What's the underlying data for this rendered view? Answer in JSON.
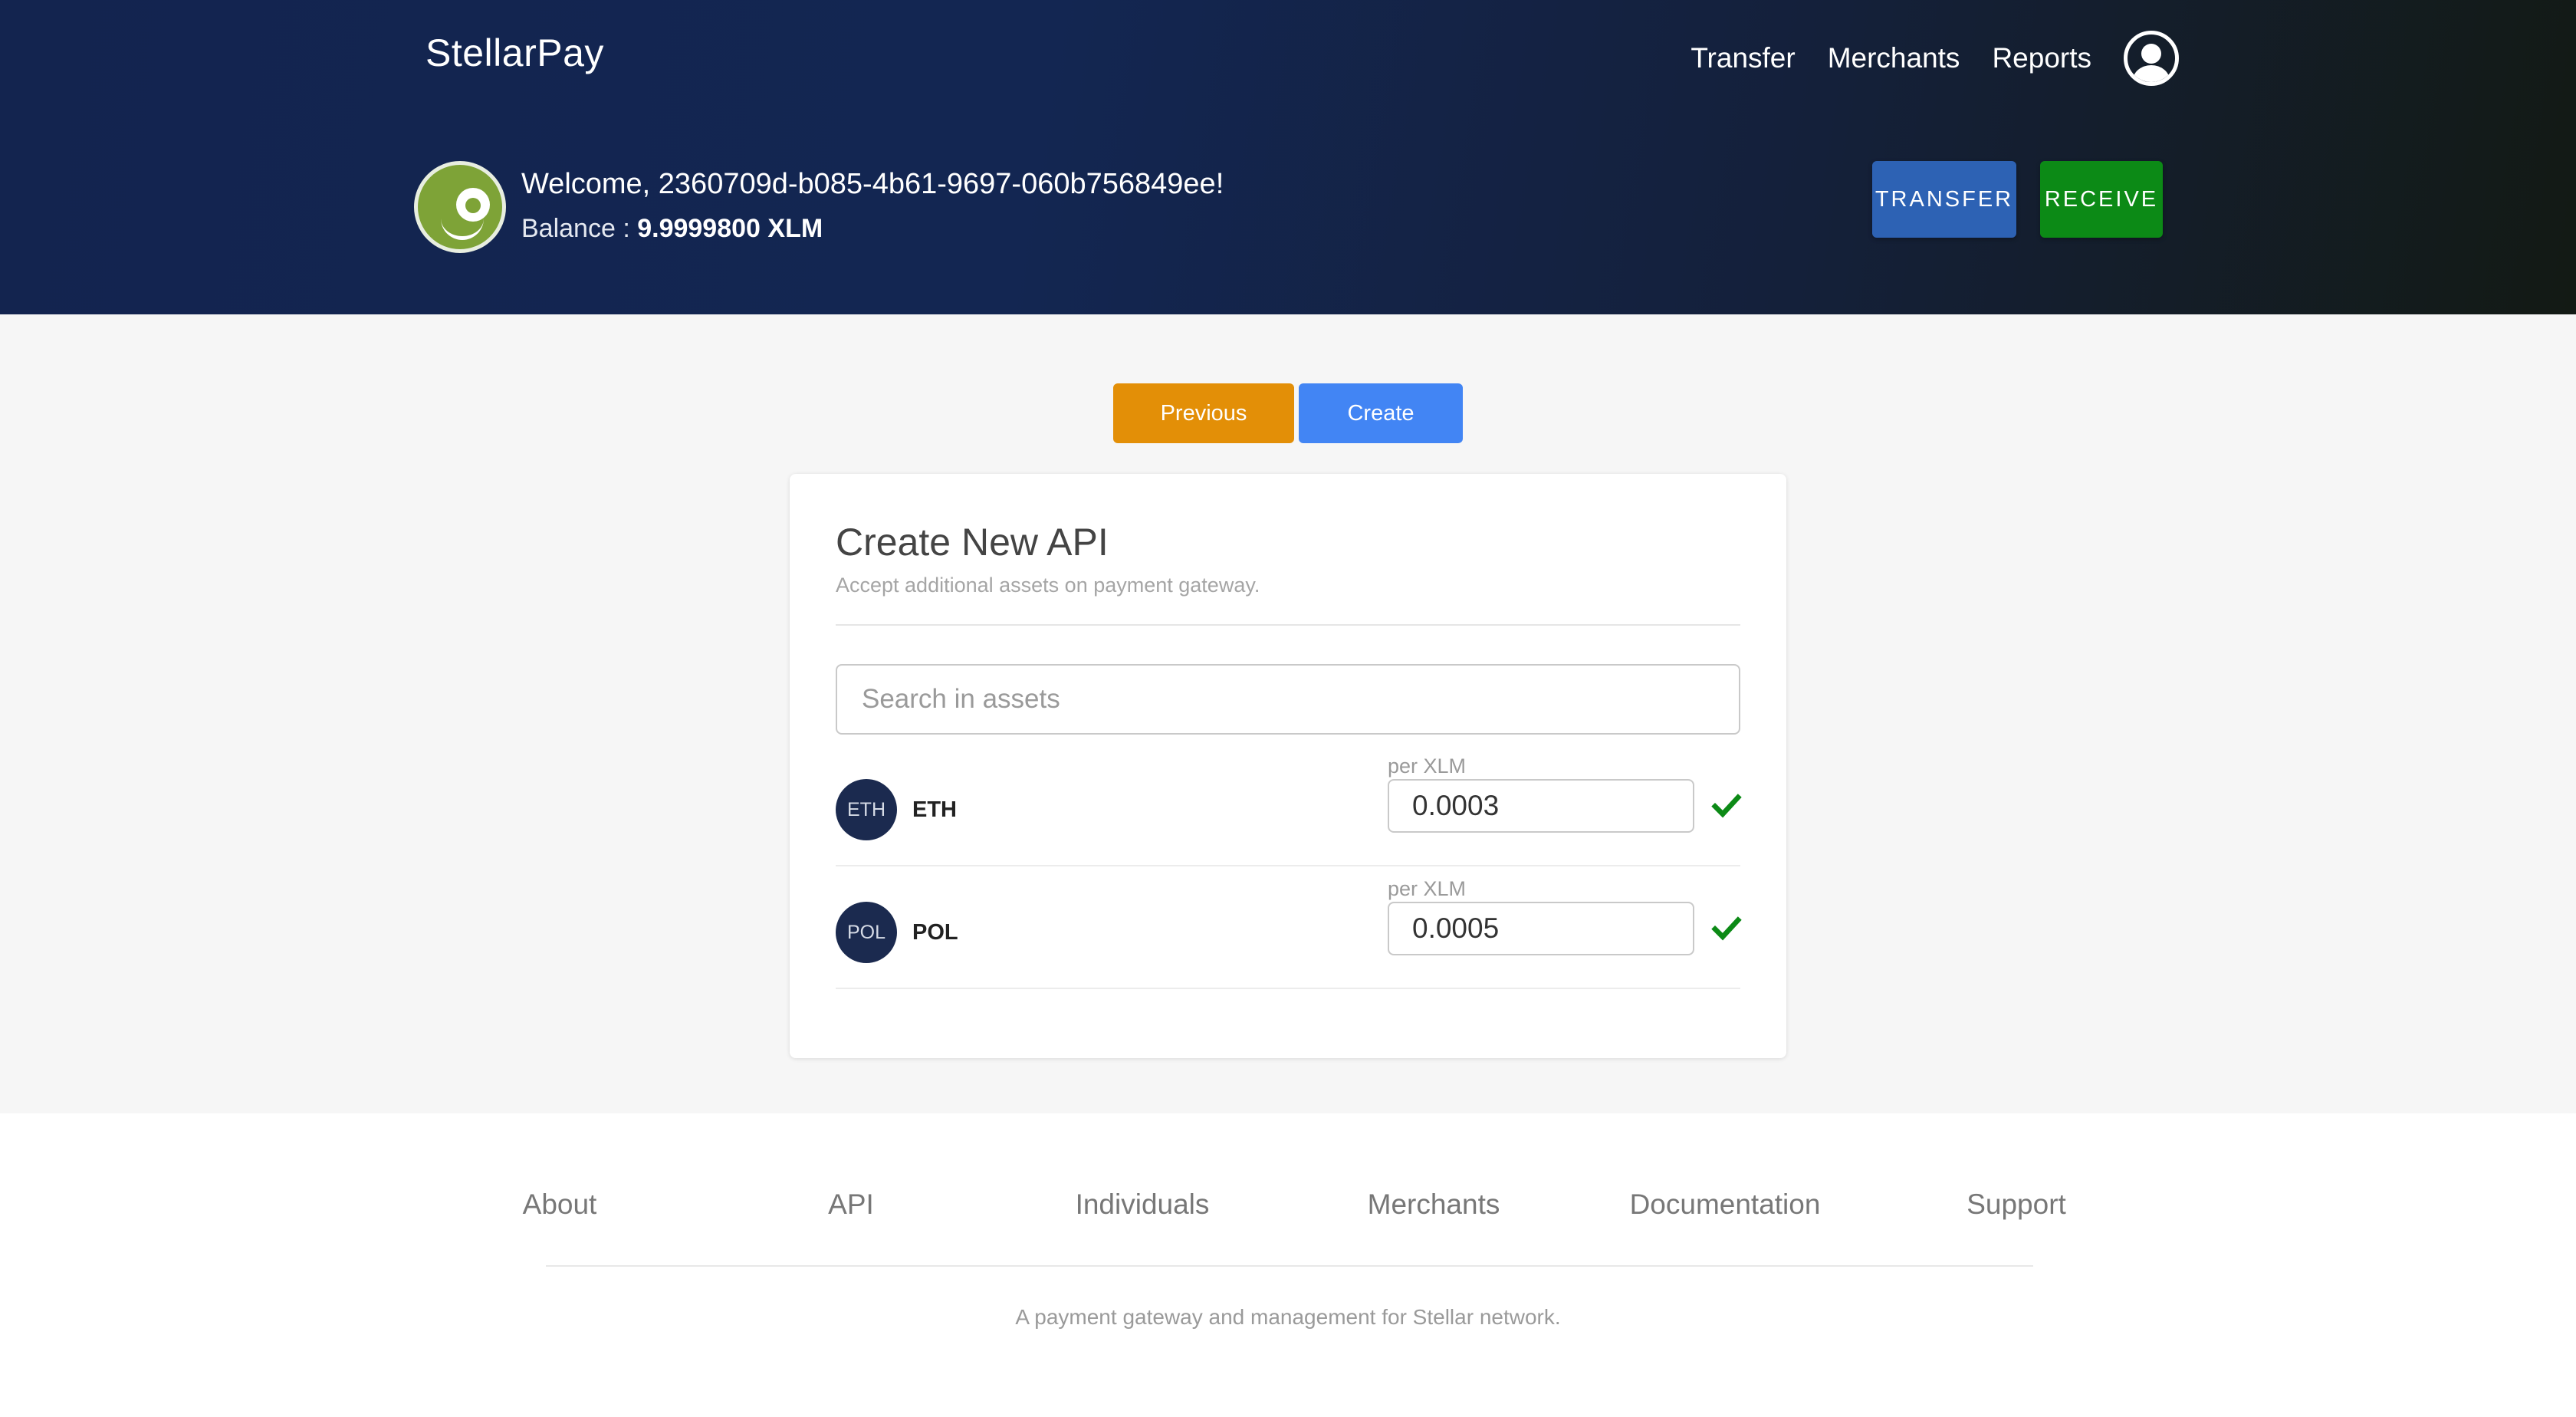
{
  "header": {
    "brand": "StellarPay",
    "nav": [
      "Transfer",
      "Merchants",
      "Reports"
    ],
    "welcome": "Welcome, 2360709d-b085-4b61-9697-060b756849ee!",
    "balance_label": "Balance : ",
    "balance_value": "9.9999800 XLM",
    "transfer_button": "TRANSFER",
    "receive_button": "RECEIVE"
  },
  "steps": {
    "previous_label": "Previous",
    "create_label": "Create"
  },
  "card": {
    "title": "Create New API",
    "subtitle": "Accept additional assets on payment gateway.",
    "search_placeholder": "Search in assets",
    "assets": [
      {
        "badge": "ETH",
        "name": "ETH",
        "rate_label": "per XLM",
        "rate": "0.0003",
        "confirmed": true
      },
      {
        "badge": "POL",
        "name": "POL",
        "rate_label": "per XLM",
        "rate": "0.0005",
        "confirmed": true
      }
    ]
  },
  "footer": {
    "links": [
      "About",
      "API",
      "Individuals",
      "Merchants",
      "Documentation",
      "Support"
    ],
    "tagline": "A payment gateway and management for Stellar network."
  },
  "colors": {
    "header_bg": "#13244f",
    "transfer": "#2d62b4",
    "receive": "#0c8a16",
    "previous": "#e38f07",
    "create": "#4285f4",
    "check": "#0c8a16",
    "asset_badge": "#1b2a4f"
  },
  "icons": {
    "user": "user-circle-icon",
    "avatar": "green-eye-avatar",
    "check": "check-icon"
  }
}
